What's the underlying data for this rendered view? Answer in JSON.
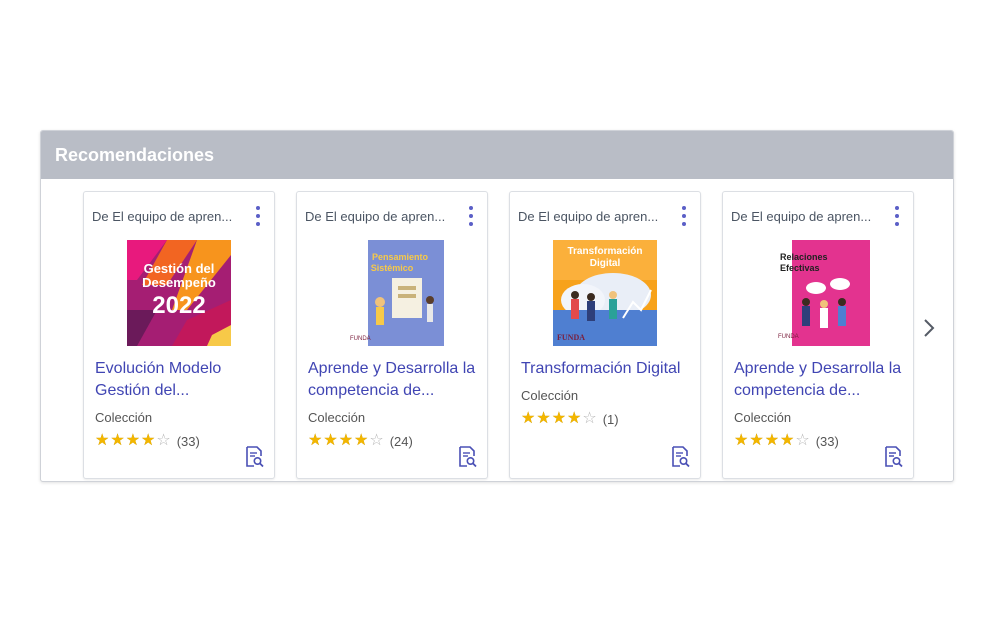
{
  "panel": {
    "title": "Recomendaciones"
  },
  "cards": [
    {
      "source": "De El equipo de apren...",
      "title": "Evolución Modelo Gestión del...",
      "type": "Colección",
      "rating": 4,
      "count": "(33)",
      "thumb": {
        "line1": "Gestión del",
        "line2": "Desempeño",
        "line3": "2022"
      }
    },
    {
      "source": "De El equipo de apren...",
      "title": "Aprende y Desarrolla la competencia de...",
      "type": "Colección",
      "rating": 4,
      "count": "(24)",
      "thumb": {
        "line1": "Pensamiento",
        "line2": "Sistémico",
        "logo": "FUNDA"
      }
    },
    {
      "source": "De El equipo de apren...",
      "title": "Transformación Digital",
      "type": "Colección",
      "rating": 4,
      "count": "(1)",
      "thumb": {
        "line1": "Transformación",
        "line2": "Digital",
        "logo": "FUNDA"
      }
    },
    {
      "source": "De El equipo de apren...",
      "title": "Aprende y Desarrolla la competencia de...",
      "type": "Colección",
      "rating": 4,
      "count": "(33)",
      "thumb": {
        "line1": "Relaciones",
        "line2": "Efectivas",
        "logo": "FUNDA"
      }
    }
  ],
  "colors": {
    "header_bg": "#b9bdc6",
    "link": "#4045b3",
    "star": "#f3b600",
    "kebab": "#5b5fc7"
  }
}
